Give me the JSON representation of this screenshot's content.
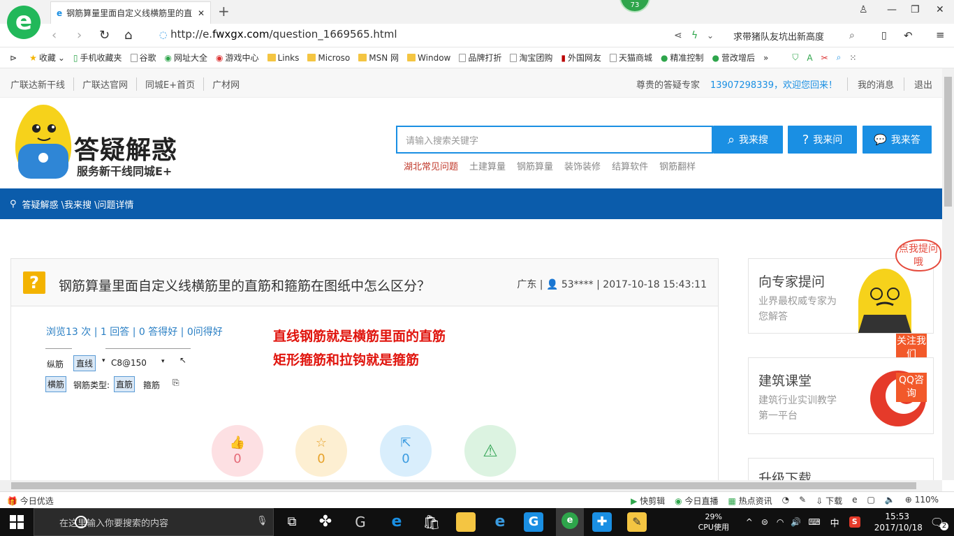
{
  "browser": {
    "tab_title": "钢筋算量里面自定义线横筋里的直",
    "badge_count": "73",
    "url_prefix": "http://e.",
    "url_domain": "fwxgx.com",
    "url_path": "/question_1669565.html",
    "hot_search": "求带猪队友坑出新高度"
  },
  "bookmarks": [
    "收藏",
    "手机收藏夹",
    "谷歌",
    "网址大全",
    "游戏中心",
    "Links",
    "Microso",
    "MSN 网",
    "Window",
    "品牌打折",
    "淘宝团购",
    "外国网友",
    "天猫商城",
    "精准控制",
    "营改增后"
  ],
  "topbar": {
    "links": [
      "广联达新干线",
      "广联达官网",
      "同城E+首页",
      "广材网"
    ],
    "welcome_label": "尊贵的答疑专家",
    "user_greeting": "13907298339，欢迎您回来！",
    "messages": "我的消息",
    "logout": "退出"
  },
  "logo": {
    "title": "答疑解惑",
    "subtitle": "服务新干线同城E+"
  },
  "search": {
    "placeholder": "请输入搜索关键字",
    "search_btn": "我来搜",
    "ask_btn": "我来问",
    "answer_btn": "我来答",
    "hot_links": [
      "湖北常见问题",
      "土建算量",
      "钢筋算量",
      "装饰装修",
      "结算软件",
      "钢筋翻样"
    ]
  },
  "breadcrumb": "答疑解惑 \\我来搜 \\问题详情",
  "question": {
    "title": "钢筋算量里面自定义线横筋里的直筋和箍筋在图纸中怎么区分？",
    "region": "广东 |",
    "user": "53****",
    "time": "| 2017-10-18 15:43:11",
    "stats": "浏览13 次 | 1 回答 | 0 答得好 | 0问得好",
    "annotation_line1": "直线钢筋就是横筋里面的直筋",
    "annotation_line2": "矩形箍筋和拉钩就是箍筋",
    "shot": {
      "r1_a": "纵筋",
      "r1_b": "直线",
      "r1_c": "C8@150",
      "r2_a": "横筋",
      "r2_b": "钢筋类型:",
      "r2_c": "直筋",
      "r2_d": "箍筋"
    },
    "actions": {
      "like": "0",
      "favorite": "0",
      "share": "0"
    }
  },
  "sidebar": {
    "expert_title": "向专家提问",
    "expert_sub": "业界最权威专家为您解答",
    "bubble": "点我提问哦",
    "follow": "关注我们",
    "class_title": "建筑课堂",
    "class_sub": "建筑行业实训教学第一平台",
    "qq": "QQ咨询",
    "download_title": "升级下载"
  },
  "statusbar": {
    "left": "今日优选",
    "items": [
      "快剪辑",
      "今日直播",
      "热点资讯",
      "下载",
      "110%"
    ]
  },
  "taskbar": {
    "search_placeholder": "在这里输入你要搜索的内容",
    "cpu": "29%",
    "cpu_label": "CPU使用",
    "ime": "中",
    "time": "15:53",
    "date": "2017/10/18",
    "notif": "2"
  }
}
